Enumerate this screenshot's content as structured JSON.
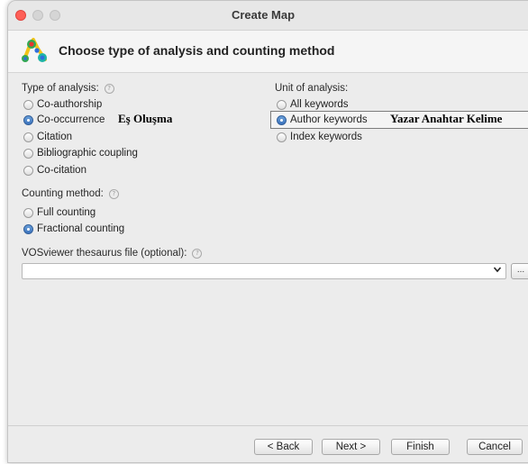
{
  "window": {
    "title": "Create Map"
  },
  "header": {
    "title": "Choose type of analysis and counting method"
  },
  "type_of_analysis": {
    "label": "Type of analysis:",
    "options": [
      {
        "label": "Co-authorship",
        "selected": false
      },
      {
        "label": "Co-occurrence",
        "selected": true
      },
      {
        "label": "Citation",
        "selected": false
      },
      {
        "label": "Bibliographic coupling",
        "selected": false
      },
      {
        "label": "Co-citation",
        "selected": false
      }
    ]
  },
  "unit_of_analysis": {
    "label": "Unit of analysis:",
    "options": [
      {
        "label": "All keywords",
        "selected": false
      },
      {
        "label": "Author keywords",
        "selected": true
      },
      {
        "label": "Index keywords",
        "selected": false
      }
    ]
  },
  "counting_method": {
    "label": "Counting method:",
    "options": [
      {
        "label": "Full counting",
        "selected": false
      },
      {
        "label": "Fractional counting",
        "selected": true
      }
    ]
  },
  "thesaurus": {
    "label": "VOSviewer thesaurus file (optional):",
    "value": "",
    "browse_label": "..."
  },
  "annotations": {
    "co_occurrence": "Eş Oluşma",
    "author_keywords": "Yazar Anahtar Kelime"
  },
  "buttons": {
    "back": "< Back",
    "next": "Next >",
    "finish": "Finish",
    "cancel": "Cancel"
  },
  "icons": {
    "help": "?",
    "dropdown": "❯"
  },
  "colors": {
    "close_button": "#fe5f57",
    "radio_selected": "#3b73bd",
    "window_background": "#ececec"
  }
}
